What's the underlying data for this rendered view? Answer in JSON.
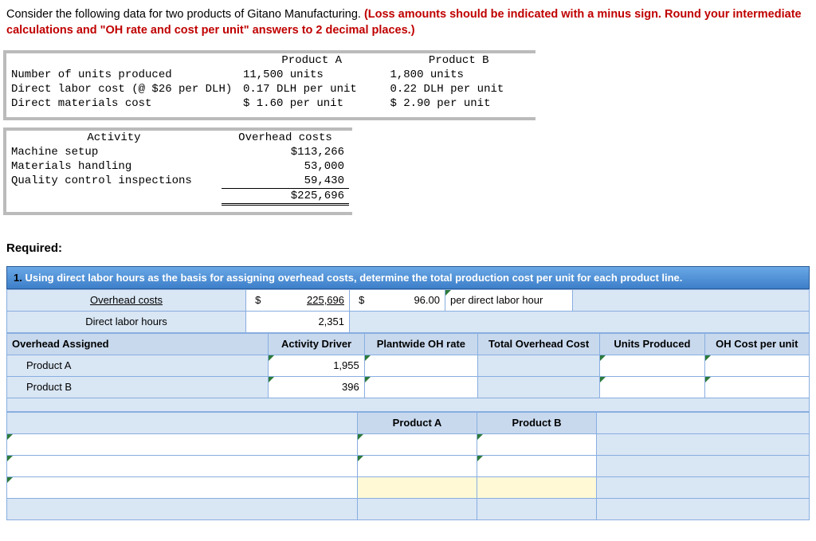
{
  "instructions": {
    "lead": "Consider the following data for two products of Gitano Manufacturing. ",
    "red": "(Loss amounts should be indicated with a minus sign. Round your intermediate calculations and \"OH rate and cost per unit\" answers to 2 decimal places.)"
  },
  "products_table": {
    "headers": [
      "",
      "Product A",
      "Product B"
    ],
    "rows": [
      [
        "Number of units produced",
        "11,500 units",
        "1,800 units"
      ],
      [
        "Direct labor cost (@ $26 per DLH)",
        "0.17 DLH per unit",
        "0.22 DLH per unit"
      ],
      [
        "Direct materials cost",
        "$ 1.60 per unit",
        "$ 2.90 per unit"
      ]
    ]
  },
  "overhead_table": {
    "headers": [
      "Activity",
      "Overhead costs"
    ],
    "rows": [
      [
        "Machine setup",
        "$113,266"
      ],
      [
        "Materials handling",
        "53,000"
      ],
      [
        "Quality control inspections",
        "59,430"
      ]
    ],
    "total": "$225,696"
  },
  "required_label": "Required:",
  "question": {
    "num": "1.",
    "text": "Using direct labor hours as the basis for assigning overhead costs, determine the total production cost per unit for each product line."
  },
  "calc": {
    "row1_label": "Overhead costs",
    "row1_sym": "$",
    "row1_val": "225,696",
    "row1_rate_sym": "$",
    "row1_rate": "96.00",
    "row1_rate_label": "per direct labor hour",
    "row2_label": "Direct labor hours",
    "row2_val": "2,351"
  },
  "assigned": {
    "header": "Overhead Assigned",
    "cols": [
      "Activity Driver",
      "Plantwide OH rate",
      "Total Overhead Cost",
      "Units Produced",
      "OH Cost per unit"
    ],
    "rowA_label": "Product A",
    "rowA_driver": "1,955",
    "rowB_label": "Product B",
    "rowB_driver": "396"
  },
  "bottom": {
    "colA": "Product A",
    "colB": "Product B"
  }
}
